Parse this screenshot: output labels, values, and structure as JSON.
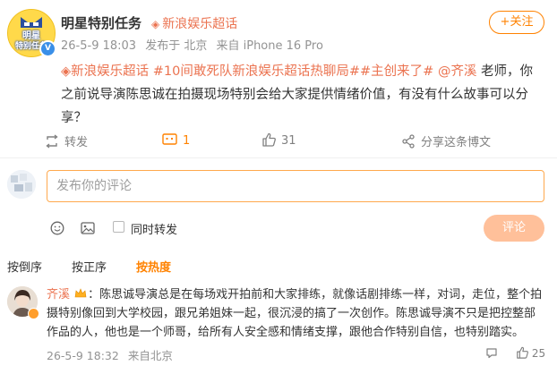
{
  "post": {
    "avatar_text_line1": "明星",
    "avatar_text_line2": "特别任务",
    "username": "明星特别任务",
    "super_topic_tag": "新浪娱乐超话",
    "meta_time": "26-5-9 18:03",
    "meta_sent_from": "发布于 北京",
    "meta_device": "来自 iPhone 16 Pro",
    "follow_label": "+关注",
    "body_topic_chip": "新浪娱乐超话",
    "body_hashtag1": "#10间敢死队新浪娱乐超话热聊局#",
    "body_hashtag2": "#主创来了#",
    "body_mention": "@齐溪",
    "body_text": "老师，你之前说导演陈思诚在拍摄现场特别会给大家提供情绪价值，有没有什么故事可以分享？"
  },
  "actions": {
    "repost_label": "转发",
    "comment_count": "1",
    "like_count": "31",
    "share_label": "分享这条博文"
  },
  "composer": {
    "placeholder": "发布你的评论",
    "also_repost_label": "同时转发",
    "submit_label": "评论"
  },
  "sort_tabs": [
    "按倒序",
    "按正序",
    "按热度"
  ],
  "comment": {
    "username": "齐溪",
    "text": "：陈思诚导演总是在每场戏开拍前和大家排练，就像话剧排练一样，对词，走位，整个拍摄特别像回到大学校园，跟兄弟姐妹一起，很沉浸的搞了一次创作。陈思诚导演不只是把控整部作品的人，他也是一个师哥，给所有人安全感和情绪支撑，跟他合作特别自信，也特别踏实。",
    "time": "26-5-9 18:32",
    "location": "来自北京",
    "like_count": "25"
  },
  "colors": {
    "accent_orange": "#ff8200",
    "topic_orange": "#eb7350",
    "muted_gray": "#939393"
  },
  "icons": [
    "verified-badge-icon",
    "super-topic-diamond-icon",
    "repost-icon",
    "comment-icon",
    "like-icon",
    "share-icon",
    "emoji-icon",
    "image-icon",
    "gold-vip-badge-icon"
  ]
}
